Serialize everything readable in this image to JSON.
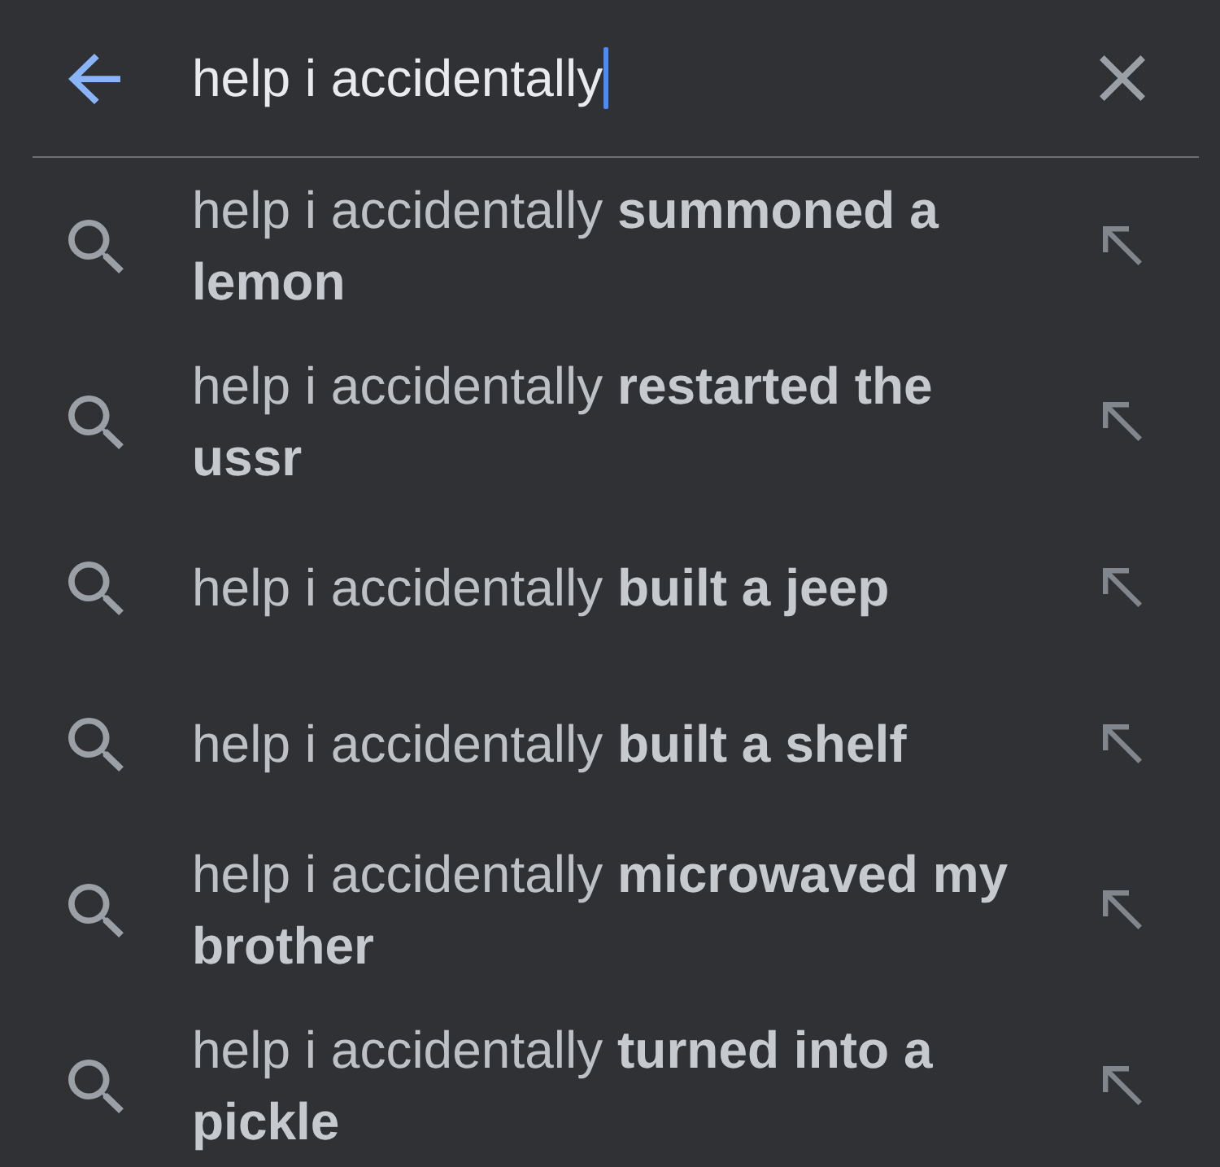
{
  "search_field": {
    "value": "help i accidentally",
    "focused": true
  },
  "suggestions": [
    {
      "text": "help i accidentally **summoned a lemon**"
    },
    {
      "text": "help i accidentally **restarted the ussr**"
    },
    {
      "text": "help i accidentally **built a jeep**"
    },
    {
      "text": "help i accidentally **built a shelf**"
    },
    {
      "text": "help i accidentally **microwaved my brother**"
    },
    {
      "text": "help i accidentally **turned into a pickle**"
    }
  ]
}
